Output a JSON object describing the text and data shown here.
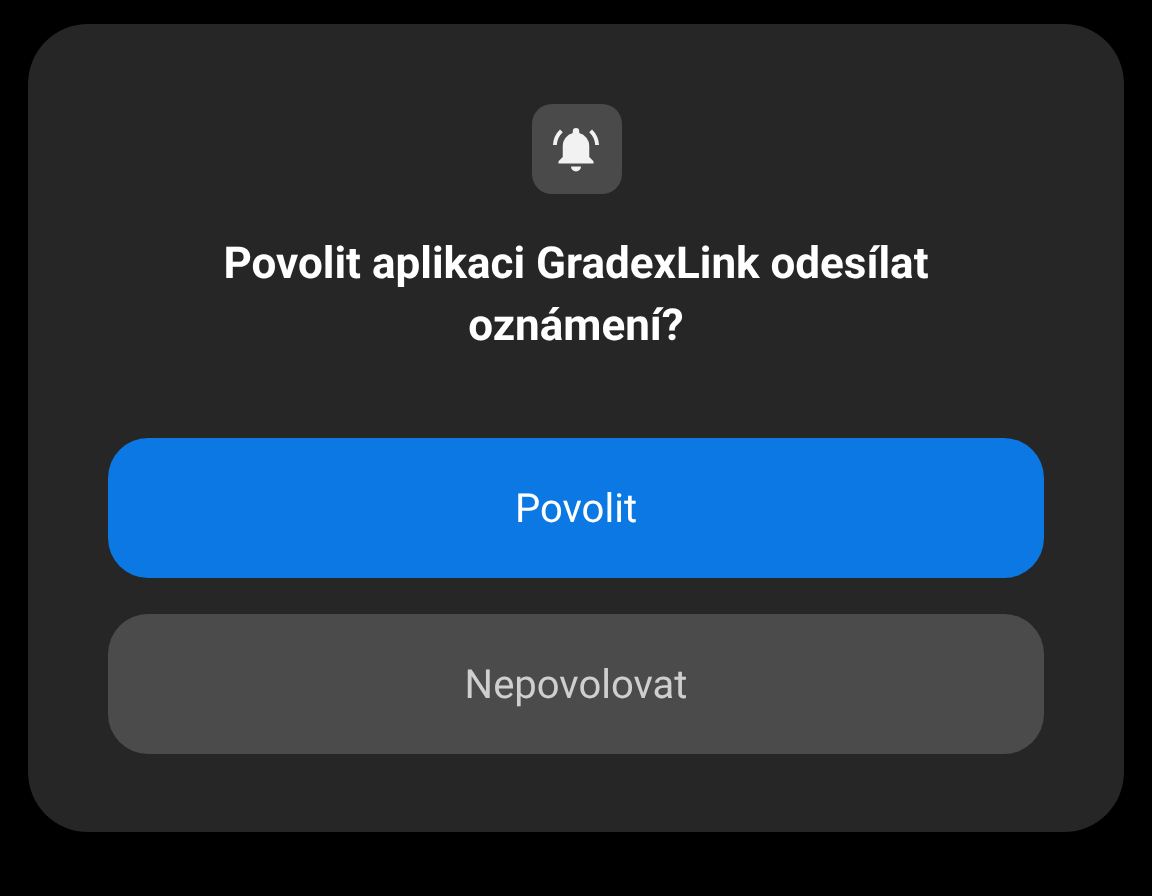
{
  "dialog": {
    "title": "Povolit aplikaci GradexLink odesílat oznámení?",
    "buttons": [
      {
        "label": "Povolit",
        "kind": "primary"
      },
      {
        "label": "Nepovolovat",
        "kind": "secondary"
      }
    ]
  }
}
